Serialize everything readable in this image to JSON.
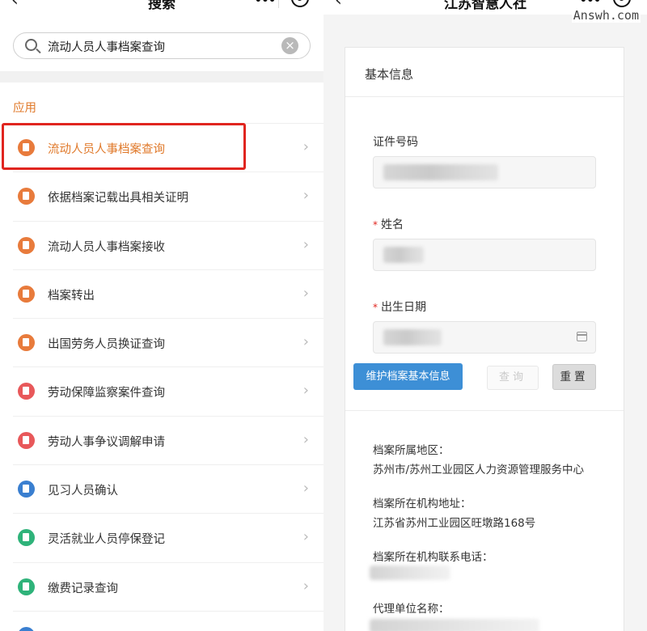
{
  "left": {
    "title": "搜索",
    "back_icon": "‹",
    "search": {
      "value": "流动人员人事档案查询",
      "clear_icon": "×"
    },
    "section_title": "应用",
    "items": [
      {
        "label": "流动人员人事档案查询",
        "color": "#e87b3c"
      },
      {
        "label": "依据档案记载出具相关证明",
        "color": "#e87b3c"
      },
      {
        "label": "流动人员人事档案接收",
        "color": "#e87b3c"
      },
      {
        "label": "档案转出",
        "color": "#e87b3c"
      },
      {
        "label": "出国劳务人员换证查询",
        "color": "#e87b3c"
      },
      {
        "label": "劳动保障监察案件查询",
        "color": "#e8585a"
      },
      {
        "label": "劳动人事争议调解申请",
        "color": "#e8585a"
      },
      {
        "label": "见习人员确认",
        "color": "#3a7fd0"
      },
      {
        "label": "灵活就业人员停保登记",
        "color": "#2fb37a"
      },
      {
        "label": "缴费记录查询",
        "color": "#2fb37a"
      }
    ],
    "chevron": "›"
  },
  "right": {
    "title": "江苏智慧人社",
    "back_icon": "‹",
    "watermark": "Answh.com",
    "card_title": "基本信息",
    "fields": {
      "id_label": "证件号码",
      "name_label": "姓名",
      "birth_label": "出生日期",
      "required_mark": "*"
    },
    "buttons": {
      "maintain": "维护档案基本信息",
      "query": "查询",
      "reset": "重置"
    },
    "info": {
      "region_label": "档案所属地区：",
      "region_value": "苏州市/苏州工业园区人力资源管理服务中心",
      "address_label": "档案所在机构地址：",
      "address_value": "江苏省苏州工业园区旺墩路168号",
      "phone_label": "档案所在机构联系电话：",
      "agent_label": "代理单位名称："
    }
  },
  "colors": {
    "accent": "#e0792a",
    "highlight_border": "#e0251f",
    "primary_button": "#3d8fd6"
  }
}
